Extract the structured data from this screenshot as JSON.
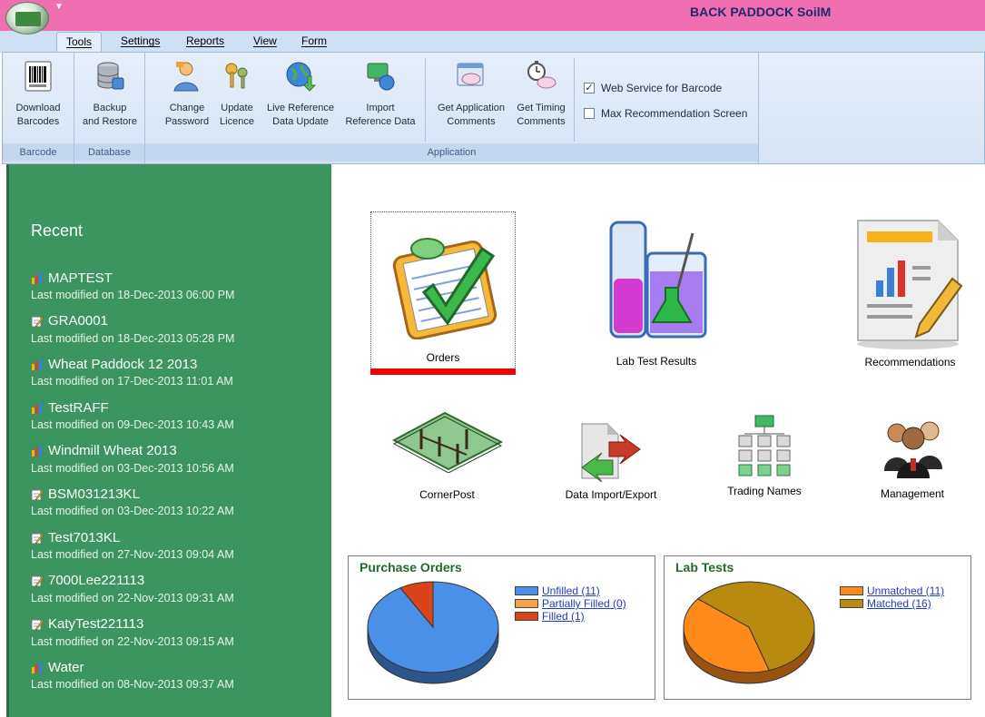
{
  "window": {
    "title": "BACK PADDOCK SoilM"
  },
  "tabs": [
    {
      "label": "Tools",
      "active": true
    },
    {
      "label": "Settings"
    },
    {
      "label": "Reports"
    },
    {
      "label": "View"
    },
    {
      "label": "Form"
    }
  ],
  "ribbon": {
    "groups": {
      "barcode": "Barcode",
      "database": "Database",
      "application": "Application"
    },
    "buttons": {
      "download_barcodes": [
        "Download",
        "Barcodes"
      ],
      "backup_restore": [
        "Backup",
        "and Restore"
      ],
      "change_password": [
        "Change",
        "Password"
      ],
      "update_licence": [
        "Update",
        "Licence"
      ],
      "live_reference": [
        "Live Reference",
        "Data Update"
      ],
      "import_reference": [
        "Import",
        "Reference Data"
      ],
      "get_app_comments": [
        "Get Application",
        "Comments"
      ],
      "get_timing_comments": [
        "Get Timing",
        "Comments"
      ]
    },
    "checkboxes": [
      {
        "label": "Web Service for Barcode",
        "checked": true
      },
      {
        "label": "Max Recommendation Screen",
        "checked": false
      }
    ]
  },
  "recent": {
    "title": "Recent",
    "items": [
      {
        "name": "MAPTEST",
        "icon": "bar-chart-icon",
        "modified": "Last modified on 18-Dec-2013 06:00 PM"
      },
      {
        "name": "GRA0001",
        "icon": "edit-form-icon",
        "modified": "Last modified on 18-Dec-2013 05:28 PM"
      },
      {
        "name": "Wheat Paddock 12 2013",
        "icon": "bar-chart-icon",
        "modified": "Last modified on 17-Dec-2013 11:01 AM"
      },
      {
        "name": "TestRAFF",
        "icon": "bar-chart-icon",
        "modified": "Last modified on 09-Dec-2013 10:43 AM"
      },
      {
        "name": "Windmill Wheat 2013",
        "icon": "bar-chart-icon",
        "modified": "Last modified on 03-Dec-2013 10:56 AM"
      },
      {
        "name": "BSM031213KL",
        "icon": "edit-form-icon",
        "modified": "Last modified on 03-Dec-2013 10:22 AM"
      },
      {
        "name": "Test7013KL",
        "icon": "edit-form-icon",
        "modified": "Last modified on 27-Nov-2013 09:04 AM"
      },
      {
        "name": "7000Lee221113",
        "icon": "edit-form-icon",
        "modified": "Last modified on 22-Nov-2013 09:31 AM"
      },
      {
        "name": "KatyTest221113",
        "icon": "edit-form-icon",
        "modified": "Last modified on 22-Nov-2013 09:15 AM"
      },
      {
        "name": "Water",
        "icon": "bar-chart-icon",
        "modified": "Last modified on 08-Nov-2013 09:37 AM"
      }
    ]
  },
  "tiles": {
    "orders": "Orders",
    "lab_test_results": "Lab Test Results",
    "recommendations": "Recommendations",
    "cornerpost": "CornerPost",
    "data_import_export": "Data Import/Export",
    "trading_names": "Trading Names",
    "management": "Management"
  },
  "chart_data": [
    {
      "type": "pie",
      "title": "Purchase Orders",
      "categories": [
        "Unfilled (11)",
        "Partially Filled (0)",
        "Filled (1)"
      ],
      "values": [
        11,
        0,
        1
      ],
      "colors": [
        "#4a8fe8",
        "#f7a14a",
        "#d9441a"
      ],
      "legend": "right"
    },
    {
      "type": "pie",
      "title": "Lab Tests",
      "categories": [
        "Unmatched (11)",
        "Matched (16)"
      ],
      "values": [
        11,
        16
      ],
      "colors": [
        "#ff8a1a",
        "#b88a10"
      ],
      "legend": "right"
    }
  ]
}
